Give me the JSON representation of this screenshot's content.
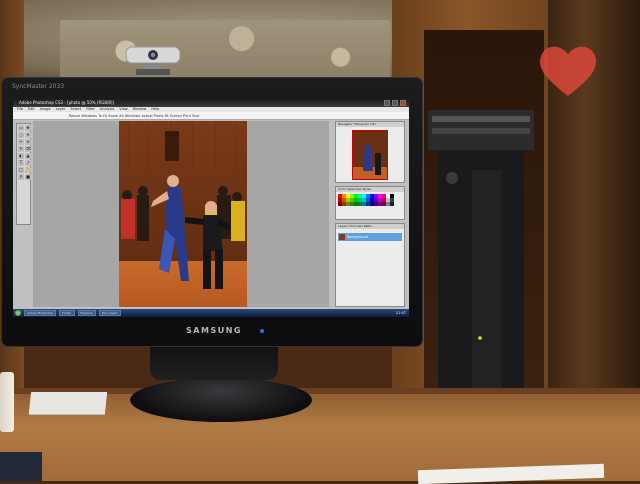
{
  "monitor": {
    "brand_top": "SyncMaster 2033",
    "brand_bezel": "SAMSUNG"
  },
  "app": {
    "title": "Adobe Photoshop CS3 - [photo @ 50% (RGB/8)]",
    "menus": [
      "File",
      "Edit",
      "Image",
      "Layer",
      "Select",
      "Filter",
      "Analysis",
      "View",
      "Window",
      "Help"
    ],
    "options_text": "Resize Windows To Fit   Zoom All Windows   Actual Pixels   Fit Screen   Print Size",
    "tools": [
      "▭",
      "✥",
      "◌",
      "⌖",
      "✂",
      "⊘",
      "✎",
      "⌫",
      "◐",
      "▲",
      "T",
      "↗",
      "▢",
      "✋",
      "⚲",
      "■"
    ],
    "panels": {
      "navigator_tab": "Navigator  Histogram  Info",
      "swatches_tab": "Color  Swatches  Styles",
      "layers_tab": "Layers  Channels  Paths",
      "layer_name": "Background"
    }
  },
  "taskbar": {
    "tasks": [
      "Adobe Photoshop",
      "Folder",
      "Explorer",
      "Document"
    ],
    "clock": "21:47"
  },
  "colors": {
    "accent": "#5ea0e0",
    "swatches": [
      "#ff0000",
      "#ff8000",
      "#ffff00",
      "#80ff00",
      "#00ff00",
      "#00ff80",
      "#00ffff",
      "#0080ff",
      "#0000ff",
      "#8000ff",
      "#ff00ff",
      "#ff0080",
      "#ffffff",
      "#000000",
      "#c00000",
      "#c06000",
      "#c0c000",
      "#60c000",
      "#00c000",
      "#00c060",
      "#00c0c0",
      "#0060c0",
      "#0000c0",
      "#6000c0",
      "#c000c0",
      "#c00060",
      "#c0c0c0",
      "#404040",
      "#800000",
      "#804000",
      "#808000",
      "#408000",
      "#008000",
      "#008040",
      "#008080",
      "#004080",
      "#000080",
      "#400080",
      "#800080",
      "#800040",
      "#808080",
      "#202020"
    ]
  }
}
